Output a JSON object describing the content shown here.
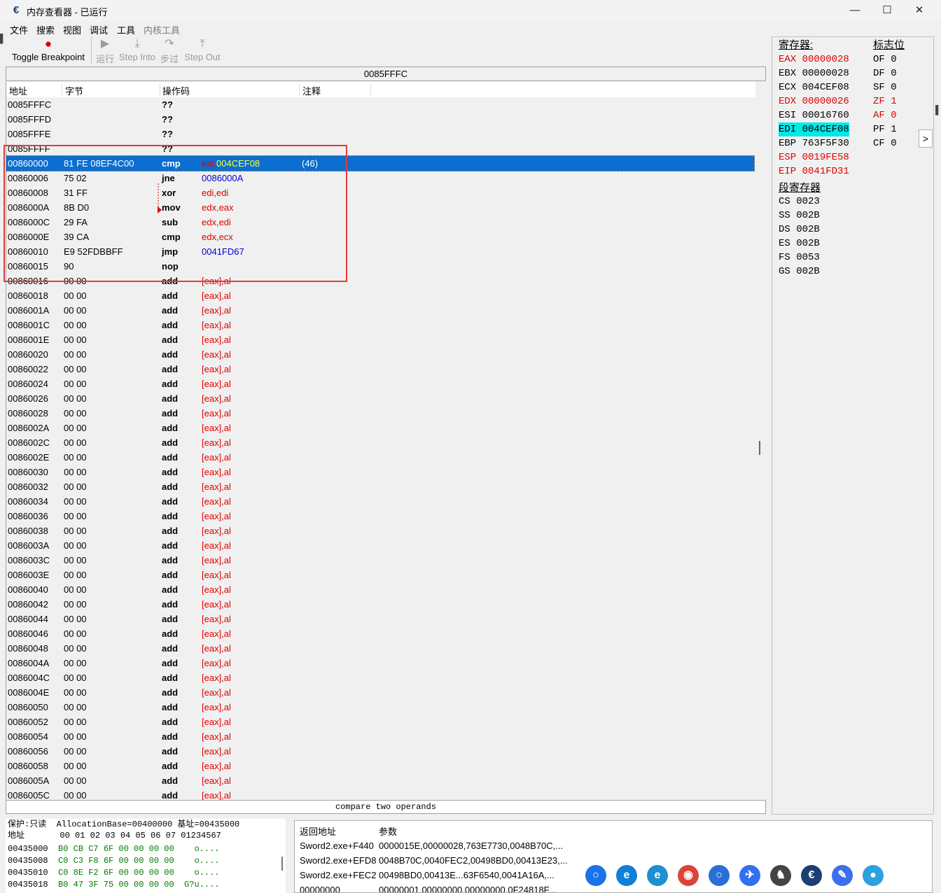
{
  "window": {
    "title": "内存查看器 - 已运行",
    "icon": "cheat-engine-icon",
    "minimize": "—",
    "maximize": "☐",
    "close": "✕"
  },
  "menu": [
    "文件",
    "搜索",
    "视图",
    "调试",
    "工具",
    "内核工具"
  ],
  "toolbar": {
    "toggle_breakpoint": "Toggle Breakpoint",
    "run": "运行",
    "step_into": "Step Into",
    "step_over": "步过",
    "step_out": "Step Out"
  },
  "address_header": "0085FFFC",
  "columns": {
    "address": "地址",
    "bytes": "字节",
    "opcode": "操作码",
    "comment": "注释"
  },
  "disassembly": [
    {
      "addr": "0085FFFC",
      "bytes": "",
      "op": "??",
      "args": "",
      "comment": ""
    },
    {
      "addr": "0085FFFD",
      "bytes": "",
      "op": "??",
      "args": "",
      "comment": ""
    },
    {
      "addr": "0085FFFE",
      "bytes": "",
      "op": "??",
      "args": "",
      "comment": ""
    },
    {
      "addr": "0085FFFF",
      "bytes": "",
      "op": "??",
      "args": "",
      "comment": ""
    },
    {
      "addr": "00860000",
      "bytes": "81 FE 08EF4C00",
      "op": "cmp",
      "args": "esi,",
      "args2": "004CEF08",
      "comment": "(46)",
      "selected": true
    },
    {
      "addr": "00860006",
      "bytes": "75 02",
      "op": "jne",
      "args": "0086000A",
      "comment": "",
      "jump": true
    },
    {
      "addr": "00860008",
      "bytes": "31 FF",
      "op": "xor",
      "args": "edi,edi",
      "comment": ""
    },
    {
      "addr": "0086000A",
      "bytes": "8B D0",
      "op": "mov",
      "args": "edx,eax",
      "comment": ""
    },
    {
      "addr": "0086000C",
      "bytes": "29 FA",
      "op": "sub",
      "args": "edx,edi",
      "comment": ""
    },
    {
      "addr": "0086000E",
      "bytes": "39 CA",
      "op": "cmp",
      "args": "edx,ecx",
      "comment": ""
    },
    {
      "addr": "00860010",
      "bytes": "E9 52FDBBFF",
      "op": "jmp",
      "args": "0041FD67",
      "comment": "",
      "jump": true
    },
    {
      "addr": "00860015",
      "bytes": "90",
      "op": "nop",
      "args": "",
      "comment": ""
    },
    {
      "addr": "00860016",
      "bytes": "00 00",
      "op": "add",
      "args": "[eax],al",
      "comment": ""
    },
    {
      "addr": "00860018",
      "bytes": "00 00",
      "op": "add",
      "args": "[eax],al",
      "comment": ""
    },
    {
      "addr": "0086001A",
      "bytes": "00 00",
      "op": "add",
      "args": "[eax],al",
      "comment": ""
    },
    {
      "addr": "0086001C",
      "bytes": "00 00",
      "op": "add",
      "args": "[eax],al",
      "comment": ""
    },
    {
      "addr": "0086001E",
      "bytes": "00 00",
      "op": "add",
      "args": "[eax],al",
      "comment": ""
    },
    {
      "addr": "00860020",
      "bytes": "00 00",
      "op": "add",
      "args": "[eax],al",
      "comment": ""
    },
    {
      "addr": "00860022",
      "bytes": "00 00",
      "op": "add",
      "args": "[eax],al",
      "comment": ""
    },
    {
      "addr": "00860024",
      "bytes": "00 00",
      "op": "add",
      "args": "[eax],al",
      "comment": ""
    },
    {
      "addr": "00860026",
      "bytes": "00 00",
      "op": "add",
      "args": "[eax],al",
      "comment": ""
    },
    {
      "addr": "00860028",
      "bytes": "00 00",
      "op": "add",
      "args": "[eax],al",
      "comment": ""
    },
    {
      "addr": "0086002A",
      "bytes": "00 00",
      "op": "add",
      "args": "[eax],al",
      "comment": ""
    },
    {
      "addr": "0086002C",
      "bytes": "00 00",
      "op": "add",
      "args": "[eax],al",
      "comment": ""
    },
    {
      "addr": "0086002E",
      "bytes": "00 00",
      "op": "add",
      "args": "[eax],al",
      "comment": ""
    },
    {
      "addr": "00860030",
      "bytes": "00 00",
      "op": "add",
      "args": "[eax],al",
      "comment": ""
    },
    {
      "addr": "00860032",
      "bytes": "00 00",
      "op": "add",
      "args": "[eax],al",
      "comment": ""
    },
    {
      "addr": "00860034",
      "bytes": "00 00",
      "op": "add",
      "args": "[eax],al",
      "comment": ""
    },
    {
      "addr": "00860036",
      "bytes": "00 00",
      "op": "add",
      "args": "[eax],al",
      "comment": ""
    },
    {
      "addr": "00860038",
      "bytes": "00 00",
      "op": "add",
      "args": "[eax],al",
      "comment": ""
    },
    {
      "addr": "0086003A",
      "bytes": "00 00",
      "op": "add",
      "args": "[eax],al",
      "comment": ""
    },
    {
      "addr": "0086003C",
      "bytes": "00 00",
      "op": "add",
      "args": "[eax],al",
      "comment": ""
    },
    {
      "addr": "0086003E",
      "bytes": "00 00",
      "op": "add",
      "args": "[eax],al",
      "comment": ""
    },
    {
      "addr": "00860040",
      "bytes": "00 00",
      "op": "add",
      "args": "[eax],al",
      "comment": ""
    },
    {
      "addr": "00860042",
      "bytes": "00 00",
      "op": "add",
      "args": "[eax],al",
      "comment": ""
    },
    {
      "addr": "00860044",
      "bytes": "00 00",
      "op": "add",
      "args": "[eax],al",
      "comment": ""
    },
    {
      "addr": "00860046",
      "bytes": "00 00",
      "op": "add",
      "args": "[eax],al",
      "comment": ""
    },
    {
      "addr": "00860048",
      "bytes": "00 00",
      "op": "add",
      "args": "[eax],al",
      "comment": ""
    },
    {
      "addr": "0086004A",
      "bytes": "00 00",
      "op": "add",
      "args": "[eax],al",
      "comment": ""
    },
    {
      "addr": "0086004C",
      "bytes": "00 00",
      "op": "add",
      "args": "[eax],al",
      "comment": ""
    },
    {
      "addr": "0086004E",
      "bytes": "00 00",
      "op": "add",
      "args": "[eax],al",
      "comment": ""
    },
    {
      "addr": "00860050",
      "bytes": "00 00",
      "op": "add",
      "args": "[eax],al",
      "comment": ""
    },
    {
      "addr": "00860052",
      "bytes": "00 00",
      "op": "add",
      "args": "[eax],al",
      "comment": ""
    },
    {
      "addr": "00860054",
      "bytes": "00 00",
      "op": "add",
      "args": "[eax],al",
      "comment": ""
    },
    {
      "addr": "00860056",
      "bytes": "00 00",
      "op": "add",
      "args": "[eax],al",
      "comment": ""
    },
    {
      "addr": "00860058",
      "bytes": "00 00",
      "op": "add",
      "args": "[eax],al",
      "comment": ""
    },
    {
      "addr": "0086005A",
      "bytes": "00 00",
      "op": "add",
      "args": "[eax],al",
      "comment": ""
    },
    {
      "addr": "0086005C",
      "bytes": "00 00",
      "op": "add",
      "args": "[eax],al",
      "comment": ""
    }
  ],
  "status_text": "compare two operands",
  "registers": {
    "title": "寄存器:",
    "items": [
      {
        "name": "EAX",
        "value": "00000028",
        "changed": true
      },
      {
        "name": "EBX",
        "value": "00000028",
        "changed": false
      },
      {
        "name": "ECX",
        "value": "004CEF08",
        "changed": false
      },
      {
        "name": "EDX",
        "value": "00000026",
        "changed": true
      },
      {
        "name": "ESI",
        "value": "00016760",
        "changed": false
      },
      {
        "name": "EDI",
        "value": "004CEF08",
        "changed": false,
        "highlight": true
      },
      {
        "name": "EBP",
        "value": "763F5F30",
        "changed": false
      },
      {
        "name": "ESP",
        "value": "0019FE58",
        "changed": true
      },
      {
        "name": "EIP",
        "value": "0041FD31",
        "changed": true
      }
    ]
  },
  "flags": {
    "title": "标志位",
    "items": [
      {
        "name": "OF",
        "value": "0",
        "changed": false
      },
      {
        "name": "DF",
        "value": "0",
        "changed": false
      },
      {
        "name": "SF",
        "value": "0",
        "changed": false
      },
      {
        "name": "ZF",
        "value": "1",
        "changed": true
      },
      {
        "name": "AF",
        "value": "0",
        "changed": true
      },
      {
        "name": "PF",
        "value": "1",
        "changed": false
      },
      {
        "name": "CF",
        "value": "0",
        "changed": false
      }
    ]
  },
  "segments": {
    "title": "段寄存器",
    "items": [
      {
        "name": "CS",
        "value": "0023"
      },
      {
        "name": "SS",
        "value": "002B"
      },
      {
        "name": "DS",
        "value": "002B"
      },
      {
        "name": "ES",
        "value": "002B"
      },
      {
        "name": "FS",
        "value": "0053"
      },
      {
        "name": "GS",
        "value": "002B"
      }
    ]
  },
  "expand_button": ">",
  "hex": {
    "info": "保护:只读  AllocationBase=00400000 基址=00435000",
    "header": "地址       00 01 02 03 04 05 06 07 01234567",
    "lines": [
      {
        "addr": "00435000",
        "bytes": "B0 CB C7 6F 00 00 00 00",
        "ascii": "   o...."
      },
      {
        "addr": "00435008",
        "bytes": "C0 C3 F8 6F 00 00 00 00",
        "ascii": "   o...."
      },
      {
        "addr": "00435010",
        "bytes": "C0 8E F2 6F 00 00 00 00",
        "ascii": "   o...."
      },
      {
        "addr": "00435018",
        "bytes": "B0 47 3F 75 00 00 00 00",
        "ascii": " G?u...."
      }
    ]
  },
  "stack": {
    "col_return": "返回地址",
    "col_params": "参数",
    "rows": [
      {
        "ret": "Sword2.exe+F440",
        "params": "0000015E,00000028,763E7730,0048B70C,..."
      },
      {
        "ret": "Sword2.exe+EFD8",
        "params": "0048B70C,0040FEC2,00498BD0,00413E23,..."
      },
      {
        "ret": "Sword2.exe+FEC2",
        "params": "00498BD0,00413E...63F6540,0041A16A,..."
      },
      {
        "ret": "00000000",
        "params": "00000001,00000000,00000000,0F24818F..."
      }
    ]
  },
  "taskbar_icons": [
    "search-icon",
    "edge-icon",
    "edge-icon",
    "chrome-icon",
    "edge-beta-icon",
    "feishu-icon",
    "game-icon",
    "cheat-engine-icon",
    "notes-icon",
    "earth-icon"
  ]
}
